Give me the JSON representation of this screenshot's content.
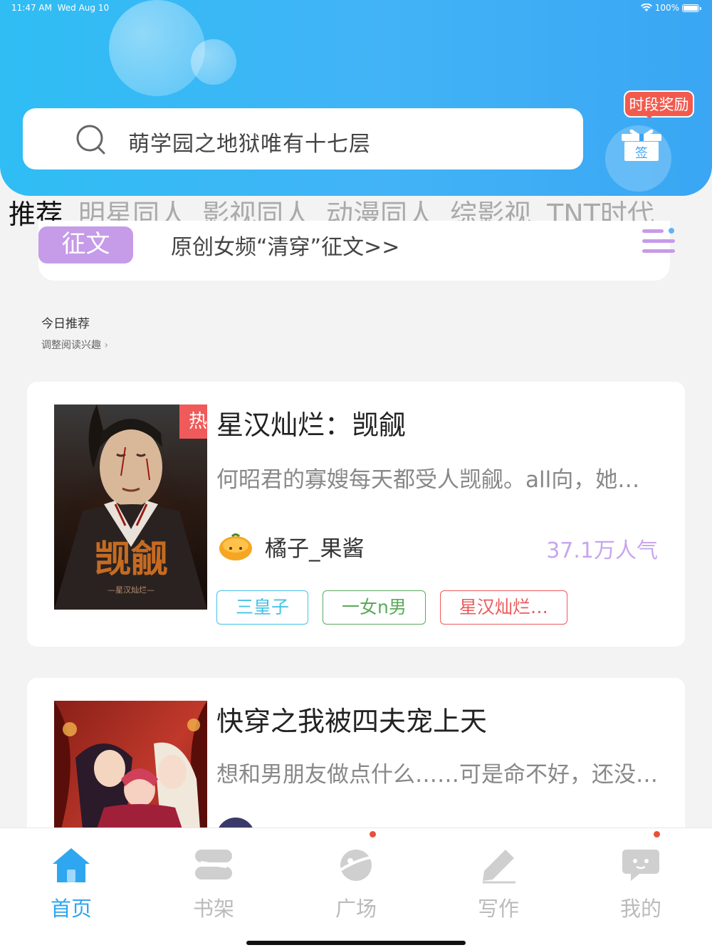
{
  "status_bar": {
    "time": "11:47 AM",
    "date": "Wed Aug 10",
    "battery": "100%"
  },
  "search": {
    "placeholder": "萌学园之地狱唯有十七层"
  },
  "reward": {
    "tag": "时段奖励",
    "sign": "签"
  },
  "tabs": [
    "推荐",
    "明星同人",
    "影视同人",
    "动漫同人",
    "综影视",
    "TNT时代"
  ],
  "contest": {
    "badge": "征文",
    "text": "原创女频“清穿”征文>>"
  },
  "section": {
    "title": "今日推荐",
    "subtitle": "调整阅读兴趣"
  },
  "books": [
    {
      "badge": "热更",
      "title": "星汉灿烂：觊觎",
      "desc": "何昭君的寡嫂每天都受人觊觎。all向，她…",
      "author": "橘子_果酱",
      "popularity": "37.1万人气",
      "tags": [
        "三皇子",
        "一女n男",
        "星汉灿烂…"
      ]
    },
    {
      "title": "快穿之我被四夫宠上天",
      "desc": "想和男朋友做点什么……可是命不好，还没…"
    }
  ],
  "nav": [
    "首页",
    "书架",
    "广场",
    "写作",
    "我的"
  ],
  "colors": {
    "accent": "#2fa6f0",
    "header": "#42b3f6",
    "contest": "#c69be8",
    "hot": "#f05a5a",
    "popularity": "#c7a6ef"
  }
}
